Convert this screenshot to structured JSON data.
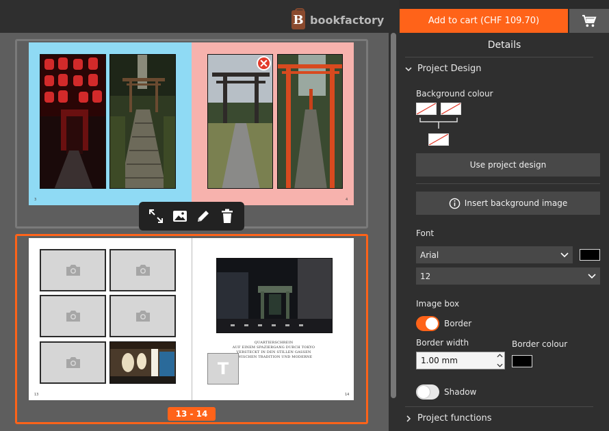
{
  "app": {
    "logo_text": "bookfactory",
    "logo_mark": "B"
  },
  "header": {
    "add_to_cart_label": "Add to cart (CHF 109.70)",
    "cart_icon": "shopping-cart-icon"
  },
  "canvas": {
    "page_badge": "13 - 14",
    "spread1": {
      "left_page_number": "3",
      "right_page_number": "4",
      "left_background_color": "#8fdaf4",
      "right_background_color": "#f7b2ad"
    },
    "spread2": {
      "left_page_number": "13",
      "right_page_number": "14",
      "caption_lines": [
        "QUARTIERSCHREIN",
        "AUF EINEM SPAZIERGANG DURCH TOKYO",
        "VERSTECKT IN DEN STILLEN GASSEN",
        "ZWISCHEN TRADITION UND MODERNE"
      ],
      "text_box_glyph": "T"
    },
    "toolbar_icons": [
      "expand-icon",
      "image-icon",
      "pencil-icon",
      "trash-icon"
    ]
  },
  "panel": {
    "title": "Details",
    "project_design": {
      "heading": "Project Design",
      "background_colour_label": "Background colour",
      "use_project_design_label": "Use project design",
      "insert_background_label": "Insert background image",
      "font_label": "Font",
      "font_value": "Arial",
      "font_size_value": "12",
      "font_color": "#000000",
      "image_box_label": "Image box",
      "border_label": "Border",
      "border_on": true,
      "border_width_label": "Border width",
      "border_width_value": "1.00 mm",
      "border_colour_label": "Border colour",
      "border_colour": "#000000",
      "shadow_label": "Shadow",
      "shadow_on": false
    },
    "project_functions": {
      "heading": "Project functions"
    }
  },
  "colors": {
    "accent": "#ff6319",
    "panel_bg": "#2f2f2f",
    "canvas_bg": "#5e5e5e"
  }
}
